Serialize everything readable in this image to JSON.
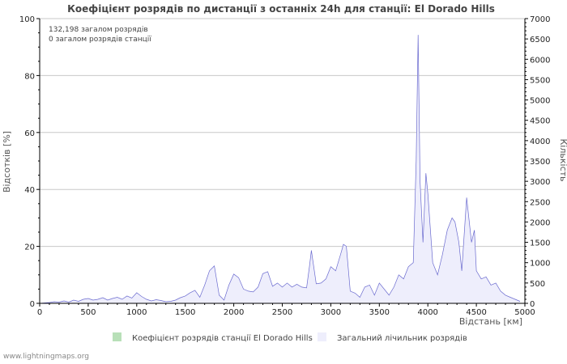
{
  "chart_data": {
    "type": "area",
    "title": "Коефіцієнт розрядів по дистанції з останніх 24h для станції: El Dorado Hills",
    "xlabel": "Відстань   [км]",
    "ylabel_left": "Відсотків   [%]",
    "ylabel_right": "Кількість",
    "xlim": [
      0,
      5000
    ],
    "ylim_left": [
      0,
      100
    ],
    "ylim_right": [
      0,
      7000
    ],
    "x_ticks": [
      0,
      500,
      1000,
      1500,
      2000,
      2500,
      3000,
      3500,
      4000,
      4500,
      5000
    ],
    "y_left_ticks": [
      0,
      20,
      40,
      60,
      80,
      100
    ],
    "y_right_ticks": [
      0,
      500,
      1000,
      1500,
      2000,
      2500,
      3000,
      3500,
      4000,
      4500,
      5000,
      5500,
      6000,
      6500,
      7000
    ],
    "grid": true,
    "legend_position": "bottom",
    "annotations": [
      "132,198 загалом розрядів",
      "0 загалом розрядів станції"
    ],
    "series": [
      {
        "name": "Коефіцієнт розрядів станції El Dorado Hills",
        "axis": "left",
        "color": "#b8e0b8",
        "values": []
      },
      {
        "name": "Загальний лічильник розрядів",
        "axis": "right",
        "color": "#6a6acf",
        "fill": "#eeeefc",
        "x": [
          0,
          100,
          150,
          200,
          250,
          300,
          350,
          400,
          450,
          500,
          550,
          600,
          650,
          700,
          750,
          800,
          850,
          900,
          950,
          1000,
          1050,
          1100,
          1150,
          1200,
          1250,
          1300,
          1350,
          1400,
          1450,
          1500,
          1550,
          1600,
          1650,
          1700,
          1750,
          1800,
          1850,
          1900,
          1950,
          2000,
          2050,
          2100,
          2150,
          2200,
          2250,
          2300,
          2350,
          2400,
          2450,
          2500,
          2550,
          2600,
          2650,
          2700,
          2750,
          2780,
          2800,
          2850,
          2900,
          2950,
          3000,
          3050,
          3100,
          3130,
          3160,
          3200,
          3250,
          3300,
          3350,
          3400,
          3450,
          3500,
          3550,
          3600,
          3650,
          3700,
          3750,
          3800,
          3850,
          3880,
          3900,
          3920,
          3950,
          3980,
          4000,
          4050,
          4100,
          4150,
          4200,
          4250,
          4280,
          4320,
          4350,
          4400,
          4450,
          4480,
          4500,
          4550,
          4600,
          4650,
          4700,
          4750,
          4800,
          4850,
          4900,
          4950
        ],
        "values": [
          0,
          20,
          40,
          30,
          60,
          30,
          80,
          50,
          100,
          120,
          80,
          100,
          140,
          80,
          120,
          150,
          100,
          180,
          130,
          260,
          170,
          100,
          60,
          90,
          70,
          40,
          50,
          80,
          140,
          180,
          260,
          320,
          150,
          450,
          800,
          920,
          200,
          80,
          450,
          720,
          630,
          350,
          300,
          280,
          400,
          730,
          780,
          420,
          500,
          400,
          500,
          400,
          470,
          400,
          380,
          900,
          1300,
          480,
          500,
          600,
          900,
          800,
          1200,
          1450,
          1400,
          300,
          250,
          150,
          400,
          450,
          200,
          500,
          350,
          200,
          400,
          700,
          600,
          900,
          1000,
          3500,
          6600,
          3000,
          1500,
          3200,
          2700,
          1000,
          700,
          1200,
          1800,
          2100,
          2000,
          1500,
          800,
          2600,
          1500,
          1800,
          800,
          600,
          650,
          450,
          500,
          300,
          200,
          150,
          100,
          50
        ]
      }
    ]
  },
  "footer": "www.lightningmaps.org"
}
